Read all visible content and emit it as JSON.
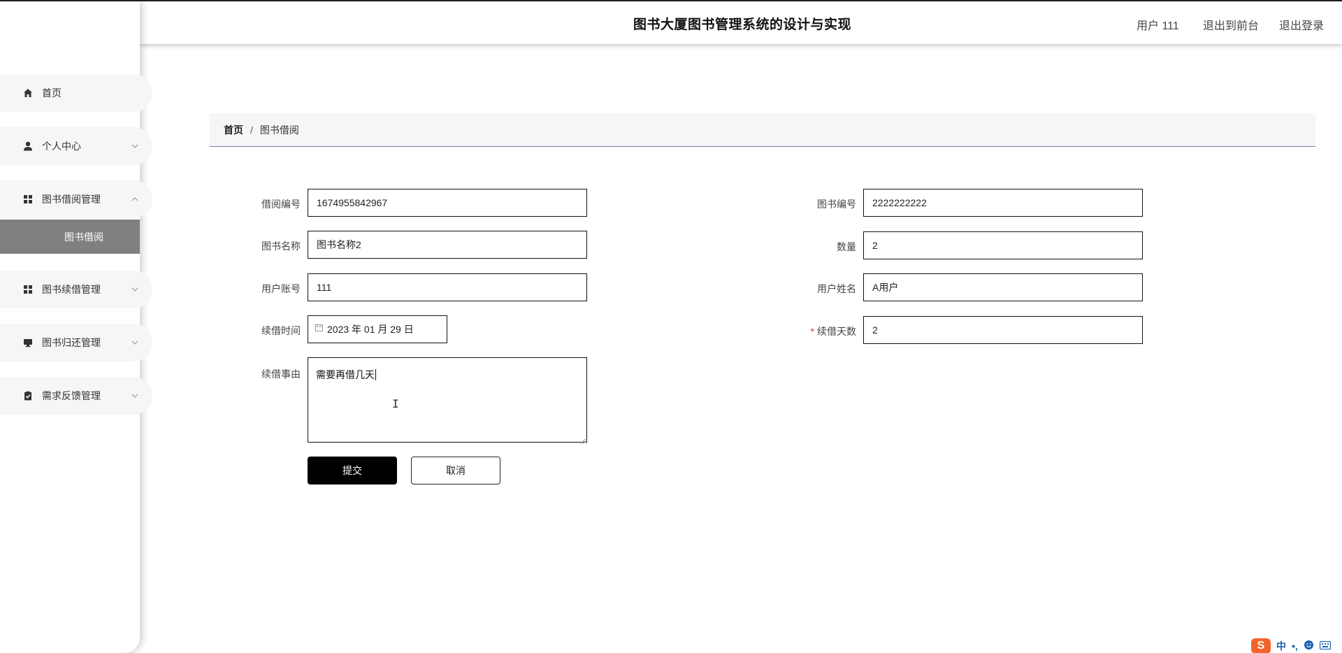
{
  "header": {
    "title": "图书大厦图书管理系统的设计与实现",
    "user": "用户 111",
    "back_to_front": "退出到前台",
    "logout": "退出登录"
  },
  "sidebar": {
    "items": [
      {
        "label": "首页",
        "icon": "home-icon"
      },
      {
        "label": "个人中心",
        "icon": "user-icon"
      },
      {
        "label": "图书借阅管理",
        "icon": "grid-icon"
      },
      {
        "label": "图书续借管理",
        "icon": "grid-icon"
      },
      {
        "label": "图书归还管理",
        "icon": "monitor-icon"
      },
      {
        "label": "需求反馈管理",
        "icon": "clipboard-check-icon"
      }
    ],
    "active_submenu": "图书借阅"
  },
  "breadcrumb": {
    "home": "首页",
    "separator": "/",
    "current": "图书借阅"
  },
  "form": {
    "borrow_no_label": "借阅编号",
    "borrow_no": "1674955842967",
    "book_no_label": "图书编号",
    "book_no": "2222222222",
    "book_name_label": "图书名称",
    "book_name": "图书名称2",
    "quantity_label": "数量",
    "quantity": "2",
    "account_label": "用户账号",
    "account": "111",
    "user_name_label": "用户姓名",
    "user_name": "A用户",
    "renew_time_label": "续借时间",
    "renew_time": "2023 年 01 月 29 日",
    "renew_days_label": "续借天数",
    "renew_days": "2",
    "required_mark": "*",
    "reason_label": "续借事由",
    "reason": "需要再借几天",
    "submit": "提交",
    "cancel": "取消"
  },
  "ime": {
    "logo": "S",
    "mode": "中",
    "punct": "•,"
  }
}
